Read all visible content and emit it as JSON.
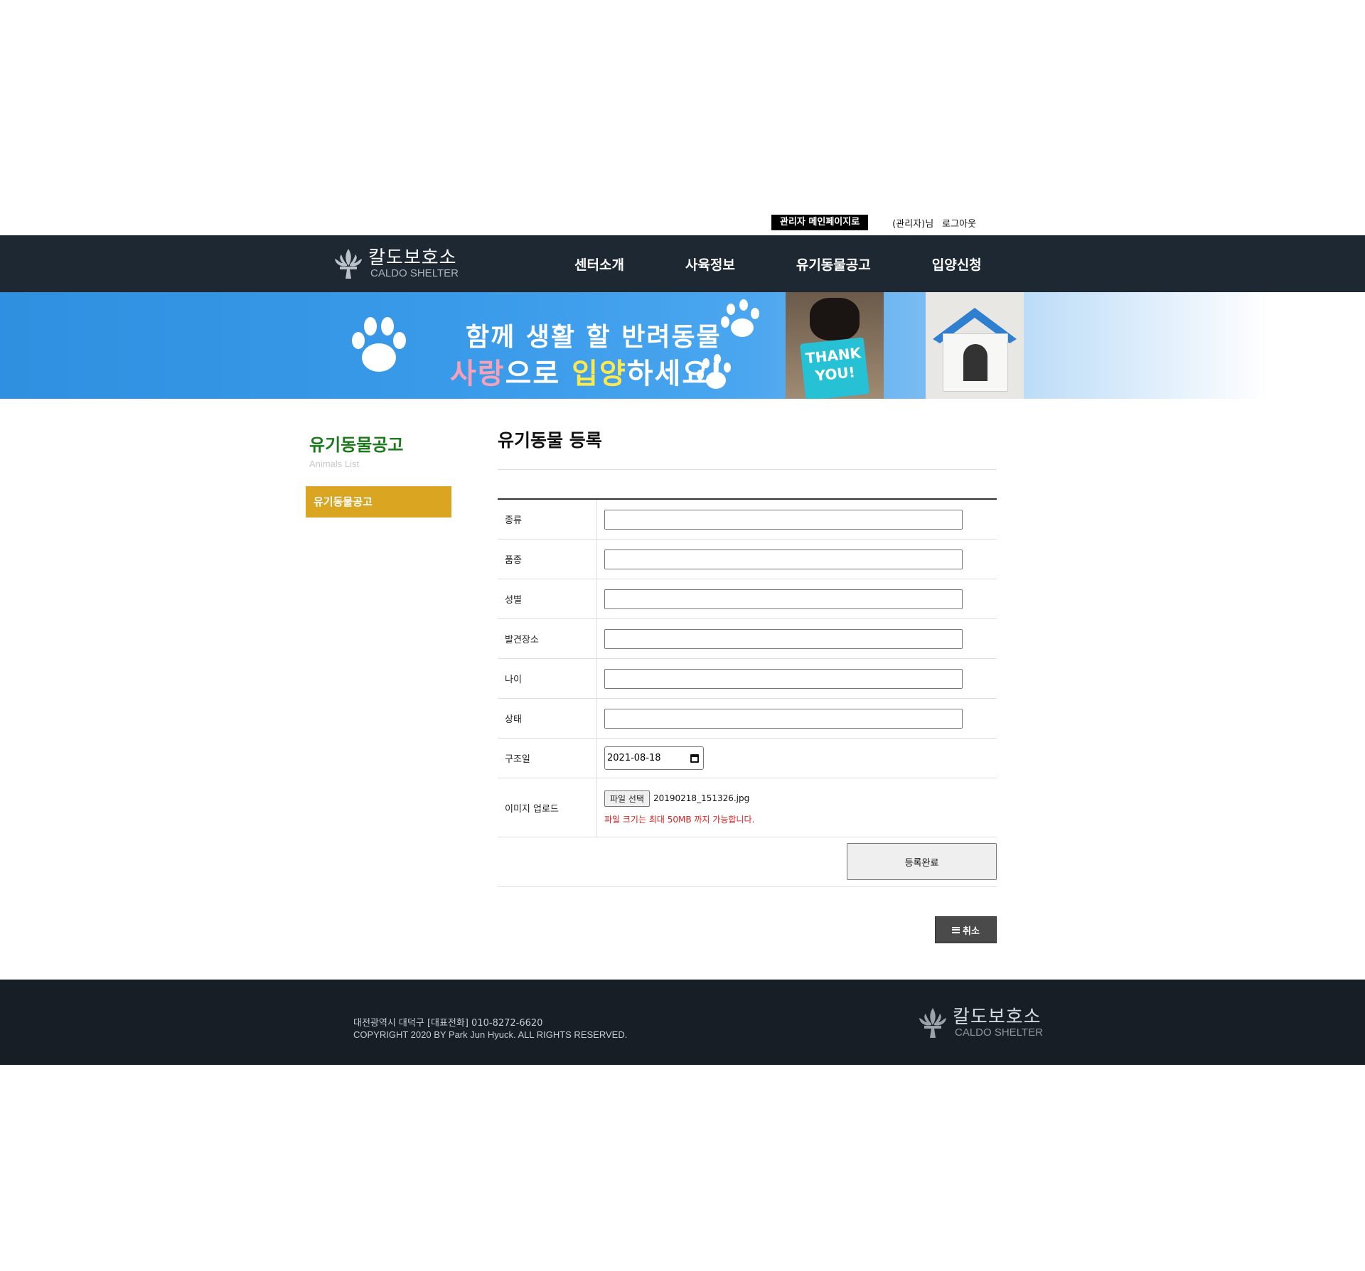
{
  "topbar": {
    "admin_button": "관리자 메인페이지로",
    "user_text": "(관리자)님",
    "logout": "로그아웃"
  },
  "logo": {
    "name_kr": "칼도보호소",
    "name_en": "CALDO SHELTER",
    "icon": "fleur-de-lis-icon"
  },
  "nav": {
    "items": [
      "센터소개",
      "사육정보",
      "유기동물공고",
      "입양신청"
    ]
  },
  "banner": {
    "line1": "함께 생활 할 반려동물",
    "line2_a": "사랑",
    "line2_b": "으로 ",
    "line2_c": "입양",
    "line2_d": "하세요!",
    "photo_sign": "THANK YOU!",
    "colors": {
      "accent_pink": "#f7a1b8",
      "accent_yellow": "#ffe94a",
      "banner_blue": "#2f8fe0"
    }
  },
  "sidebar": {
    "title": "유기동물공고",
    "subtitle": "Animals List",
    "item": "유기동물공고",
    "item_color": "#daa520"
  },
  "main": {
    "title": "유기동물 등록",
    "fields": [
      {
        "label": "종류",
        "value": ""
      },
      {
        "label": "품종",
        "value": ""
      },
      {
        "label": "성별",
        "value": ""
      },
      {
        "label": "발견장소",
        "value": ""
      },
      {
        "label": "나이",
        "value": ""
      },
      {
        "label": "상태",
        "value": ""
      }
    ],
    "rescue_date": {
      "label": "구조일",
      "value": "2021-08-18"
    },
    "upload": {
      "label": "이미지 업로드",
      "button": "파일 선택",
      "file_name": "20190218_151326.jpg",
      "note": "파일 크기는 최대 50MB 까지 가능합니다."
    },
    "submit": "등록완료",
    "cancel": "취소"
  },
  "footer": {
    "address": "대전광역시 대덕구 [대표전화] 010-8272-6620",
    "copyright": "COPYRIGHT 2020 BY Park Jun Hyuck. ALL RIGHTS RESERVED."
  }
}
